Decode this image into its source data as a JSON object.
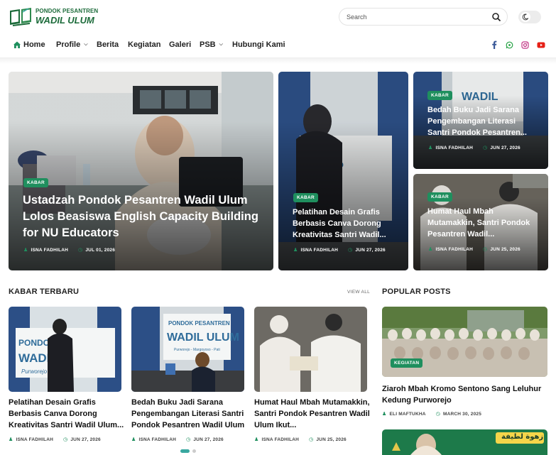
{
  "brand": {
    "top": "PONDOK PESANTREN",
    "name": "WADIL ULUM",
    "color": "#1c6b3a"
  },
  "search": {
    "placeholder": "Search"
  },
  "nav": {
    "home": "Home",
    "items": [
      "Profile",
      "Berita",
      "Kegiatan",
      "Galeri",
      "PSB",
      "Hubungi Kami"
    ]
  },
  "social": [
    "facebook-icon",
    "whatsapp-icon",
    "instagram-icon",
    "youtube-icon"
  ],
  "featured": [
    {
      "category": "KABAR",
      "title": "Ustadzah Pondok Pesantren Wadil Ulum Lolos Beasiswa English Capacity Building for NU Educators",
      "author": "ISNA FADHILAH",
      "date": "JUL 01, 2026"
    },
    {
      "category": "KABAR",
      "title": "Pelatihan Desain Grafis Berbasis Canva Dorong Kreativitas Santri Wadil...",
      "author": "ISNA FADHILAH",
      "date": "JUN 27, 2026"
    },
    {
      "category": "KABAR",
      "title": "Bedah Buku Jadi Sarana Pengembangan Literasi Santri Pondok Pesantren...",
      "author": "ISNA FADHILAH",
      "date": "JUN 27, 2026"
    },
    {
      "category": "KABAR",
      "title": "Humat Haul Mbah Mutamakkin, Santri Pondok Pesantren Wadil...",
      "author": "ISNA FADHILAH",
      "date": "JUN 25, 2026"
    }
  ],
  "latest": {
    "heading": "KABAR TERBARU",
    "view_all": "VIEW ALL",
    "posts": [
      {
        "title": "Pelatihan Desain Grafis Berbasis Canva Dorong Kreativitas Santri Wadil Ulum...",
        "author": "ISNA FADHILAH",
        "date": "JUN 27, 2026",
        "photo_text": "PONDOK WADIL ULUM Purworejo"
      },
      {
        "title": "Bedah Buku Jadi Sarana Pengembangan Literasi Santri Pondok Pesantren Wadil Ulum",
        "author": "ISNA FADHILAH",
        "date": "JUN 27, 2026",
        "photo_text": "PONDOK PESANTREN WADIL ULUM Purworejo - Margoyoso - Pati"
      },
      {
        "title": "Humat Haul Mbah Mutamakkin, Santri Pondok Pesantren Wadil Ulum Ikut...",
        "author": "ISNA FADHILAH",
        "date": "JUN 25, 2026"
      }
    ]
  },
  "popular": {
    "heading": "POPULAR POSTS",
    "posts": [
      {
        "category": "KEGIATAN",
        "title": "Ziaroh Mbah Kromo Sentono Sang Leluhur Kedung Purworejo",
        "author": "ELI MAFTUKHA",
        "date": "MARCH 30, 2025"
      }
    ],
    "banner_text": "زهوة لطيفة"
  },
  "colors": {
    "accent": "#1f8f5e",
    "teal": "#3aa8a0"
  }
}
